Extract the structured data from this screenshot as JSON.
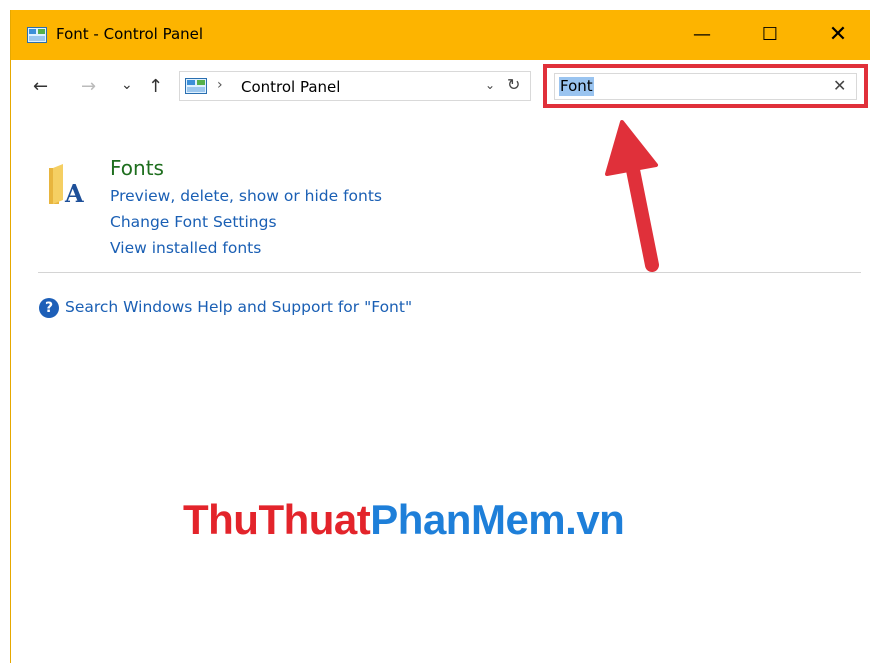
{
  "window": {
    "title": "Font - Control Panel",
    "min_glyph": "—",
    "max_glyph": "☐",
    "close_glyph": "✕"
  },
  "nav": {
    "back_glyph": "←",
    "forward_glyph": "→",
    "recent_glyph": "⌄",
    "up_glyph": "↑",
    "breadcrumb_sep": "›",
    "address_text": "Control Panel",
    "address_drop_glyph": "⌄",
    "refresh_glyph": "↻"
  },
  "search": {
    "value": "Font",
    "clear_glyph": "✕"
  },
  "results": {
    "title": "Fonts",
    "links": [
      "Preview, delete, show or hide fonts",
      "Change Font Settings",
      "View installed fonts"
    ],
    "help_glyph": "?",
    "help_text": "Search Windows Help and Support for \"Font\""
  },
  "watermark": {
    "part1": "ThuThuat",
    "part2": "PhanMem.vn"
  },
  "colors": {
    "titlebar": "#fdb400",
    "highlight": "#e0303a",
    "link": "#1a5fb4",
    "category_title": "#1e6e1e"
  }
}
